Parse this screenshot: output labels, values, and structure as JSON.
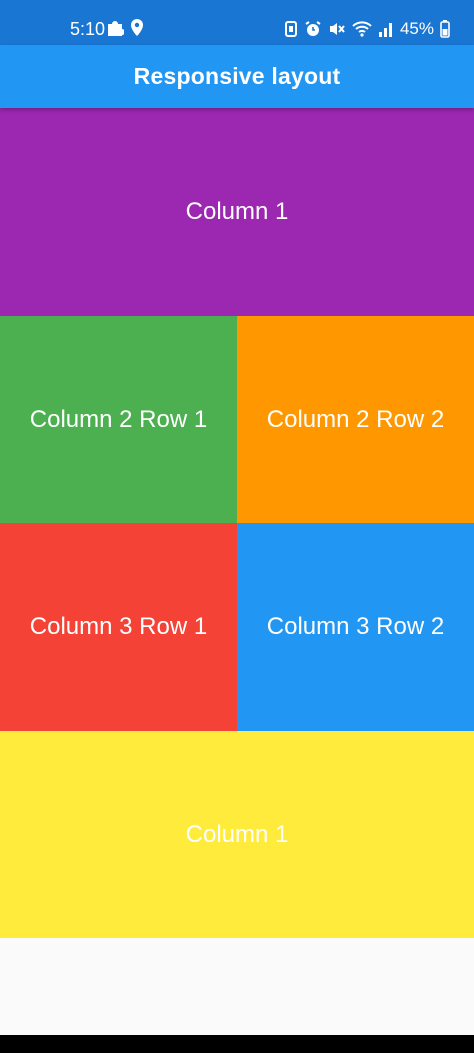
{
  "status_bar": {
    "time": "5:10",
    "battery_percent": "45%",
    "left_icons": [
      "puzzle-icon",
      "location-pin-icon"
    ],
    "right_icons": [
      "nfc-icon",
      "alarm-icon",
      "mute-icon",
      "wifi-icon",
      "signal-icon",
      "battery-icon"
    ],
    "color": "#1976d2"
  },
  "app_bar": {
    "title": "Responsive layout",
    "color": "#2196f3"
  },
  "layout": {
    "top_column": {
      "label": "Column 1",
      "color": "#9c27b0"
    },
    "column2_row1": {
      "label": "Column 2 Row 1",
      "color": "#4caf50"
    },
    "column2_row2": {
      "label": "Column 2 Row 2",
      "color": "#ff9800"
    },
    "column3_row1": {
      "label": "Column 3 Row 1",
      "color": "#f44336"
    },
    "column3_row2": {
      "label": "Column 3 Row 2",
      "color": "#2196f3"
    },
    "bottom_column": {
      "label": "Column 1",
      "color": "#ffeb3b"
    }
  }
}
